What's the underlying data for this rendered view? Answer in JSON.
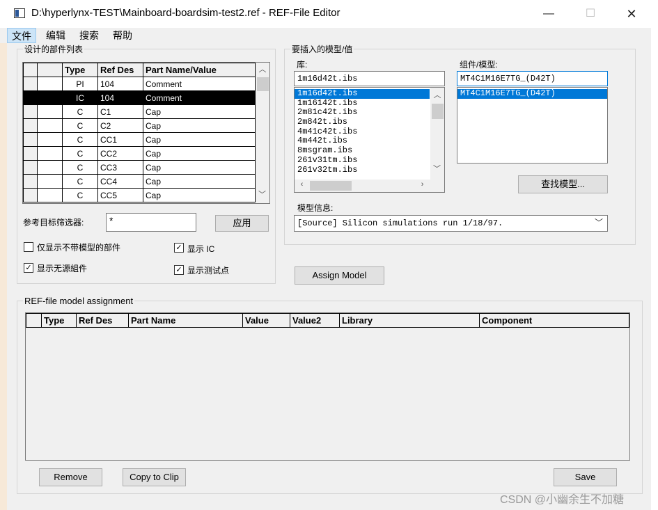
{
  "window": {
    "title": "D:\\hyperlynx-TEST\\Mainboard-boardsim-test2.ref - REF-File Editor",
    "min_glyph": "—",
    "max_glyph": "☐",
    "close_glyph": "✕"
  },
  "menu": [
    "文件",
    "编辑",
    "搜索",
    "帮助"
  ],
  "parts_group": {
    "title": "设计的部件列表",
    "columns": [
      "Type",
      "Ref Des",
      "Part Name/Value"
    ],
    "rows": [
      {
        "type": "PI",
        "ref": "104",
        "value": "Comment",
        "selected": false
      },
      {
        "type": "IC",
        "ref": "104",
        "value": "Comment",
        "selected": true
      },
      {
        "type": "C",
        "ref": "C1",
        "value": "Cap",
        "selected": false
      },
      {
        "type": "C",
        "ref": "C2",
        "value": "Cap",
        "selected": false
      },
      {
        "type": "C",
        "ref": "CC1",
        "value": "Cap",
        "selected": false
      },
      {
        "type": "C",
        "ref": "CC2",
        "value": "Cap",
        "selected": false
      },
      {
        "type": "C",
        "ref": "CC3",
        "value": "Cap",
        "selected": false
      },
      {
        "type": "C",
        "ref": "CC4",
        "value": "Cap",
        "selected": false
      },
      {
        "type": "C",
        "ref": "CC5",
        "value": "Cap",
        "selected": false
      }
    ],
    "filter_label": "参考目标筛选器:",
    "filter_value": "*",
    "apply_label": "应用",
    "checkboxes": [
      {
        "label": "仅显示不带模型的部件",
        "checked": false
      },
      {
        "label": "显示 IC",
        "checked": true
      },
      {
        "label": "显示无源組件",
        "checked": true
      },
      {
        "label": "显示测试点",
        "checked": true
      }
    ]
  },
  "model_group": {
    "title": "要插入的模型/值",
    "library_label": "库:",
    "library_value": "1m16d42t.ibs",
    "library_items": [
      "1m16d42t.ibs",
      "1m16142t.ibs",
      "2m81c42t.ibs",
      "2m842t.ibs",
      "4m41c42t.ibs",
      "4m442t.ibs",
      "8msgram.ibs",
      "261v31tm.ibs",
      "261v32tm.ibs"
    ],
    "component_label": "组件/模型:",
    "component_value": "MT4C1M16E7TG_(D42T)",
    "component_items": [
      "MT4C1M16E7TG_(D42T)"
    ],
    "find_model_label": "查找模型...",
    "model_info_label": "模型信息:",
    "model_info_value": "[Source] Silicon simulations run 1/18/97."
  },
  "assign_model_label": "Assign Model",
  "assignment_group": {
    "title": "REF-file model assignment",
    "columns": [
      "Type",
      "Ref Des",
      "Part Name",
      "Value",
      "Value2",
      "Library",
      "Component"
    ]
  },
  "buttons": {
    "remove": "Remove",
    "copy_to_clip": "Copy to Clip",
    "save": "Save"
  },
  "watermark": "CSDN @小幽余生不加糖"
}
